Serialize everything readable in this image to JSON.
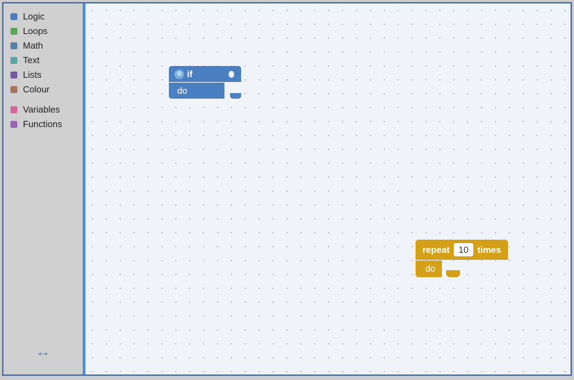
{
  "sidebar": {
    "items": [
      {
        "label": "Logic",
        "color": "#4a7fc1"
      },
      {
        "label": "Loops",
        "color": "#5ba55b"
      },
      {
        "label": "Math",
        "color": "#5b80a5"
      },
      {
        "label": "Text",
        "color": "#5ba5a5"
      },
      {
        "label": "Lists",
        "color": "#745ba5"
      },
      {
        "label": "Colour",
        "color": "#a5745b"
      },
      {
        "label": "Variables",
        "color": "#d4679a"
      },
      {
        "label": "Functions",
        "color": "#9966b8"
      }
    ]
  },
  "blocks": {
    "if_block": {
      "gear_symbol": "⚙",
      "if_label": "if",
      "do_label": "do"
    },
    "repeat_block": {
      "repeat_label": "repeat",
      "times_value": "10",
      "times_label": "times",
      "do_label": "do"
    }
  },
  "resize_arrow": "↔"
}
